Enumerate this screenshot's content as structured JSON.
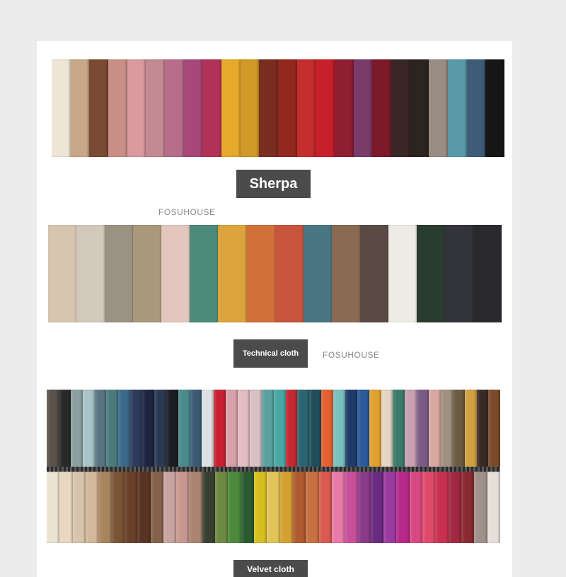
{
  "sections": {
    "sherpa": {
      "label": "Sherpa",
      "swatches": [
        "#efe6d6",
        "#c9a88a",
        "#7a4a32",
        "#c98f86",
        "#d99aa0",
        "#c48a93",
        "#b86e8a",
        "#a8487a",
        "#b2325a",
        "#e7a92a",
        "#d19a28",
        "#7a2e20",
        "#93281e",
        "#c42e2c",
        "#c8202a",
        "#8e1e30",
        "#7a3a6a",
        "#7c1a2a",
        "#3a2626",
        "#2c2420",
        "#9a8e84",
        "#5a9aa8",
        "#3e5c78",
        "#161616"
      ]
    },
    "technical": {
      "label": "Technical cloth",
      "swatches": [
        "#d6c6b0",
        "#d2c8bc",
        "#9a9282",
        "#aa987c",
        "#e3c6be",
        "#4e8a78",
        "#dca43c",
        "#d0703a",
        "#c8543c",
        "#4a7684",
        "#8a6a50",
        "#5a4a44",
        "#ecebe4",
        "#2a3c30",
        "#33333a",
        "#2a2a2e"
      ]
    },
    "velvet": {
      "label": "Velvet cloth",
      "top_swatches": [
        "#5a5248",
        "#2a2a2a",
        "#8aa0a0",
        "#a8c4c8",
        "#5a7484",
        "#4a7a7c",
        "#3a6a8a",
        "#2c3a5c",
        "#1c2440",
        "#2a3a54",
        "#1a1c22",
        "#4a8a8a",
        "#3a5a74",
        "#dce0e4",
        "#c82030",
        "#d8a0a8",
        "#e2bcc0",
        "#d8c0c4",
        "#5aa2a0",
        "#48a8a4",
        "#c42830",
        "#2a6470",
        "#1e4e5a",
        "#e46030",
        "#7ac0bc",
        "#1e3a6a",
        "#2a5a9a",
        "#e0a030",
        "#e4d4c4",
        "#3a7a6a",
        "#c8a0b0",
        "#7a5a84",
        "#d8a8a0",
        "#a09080",
        "#6a5a40",
        "#d0a040",
        "#3a2a24",
        "#7a4a2a"
      ],
      "bottom_swatches": [
        "#ece2d0",
        "#e8d8c0",
        "#d8c4ac",
        "#d4b89a",
        "#a8845e",
        "#7a5234",
        "#6a4028",
        "#5a3422",
        "#84624a",
        "#caa4a0",
        "#c89890",
        "#aa8470",
        "#3a4030",
        "#6e8a42",
        "#4a8a3a",
        "#2a5a30",
        "#d6c020",
        "#e2c45a",
        "#d4a030",
        "#b05a30",
        "#c87040",
        "#d85a50",
        "#e87aa8",
        "#c8509a",
        "#8a3a8a",
        "#6a2a80",
        "#9a3aa0",
        "#b8288a",
        "#d84880",
        "#e04a6a",
        "#c83050",
        "#a02840",
        "#8a2a30",
        "#a0908a",
        "#e6e0d8"
      ]
    }
  },
  "watermarks": [
    "FOSUHOUSE",
    "FOSUHOUSE"
  ]
}
